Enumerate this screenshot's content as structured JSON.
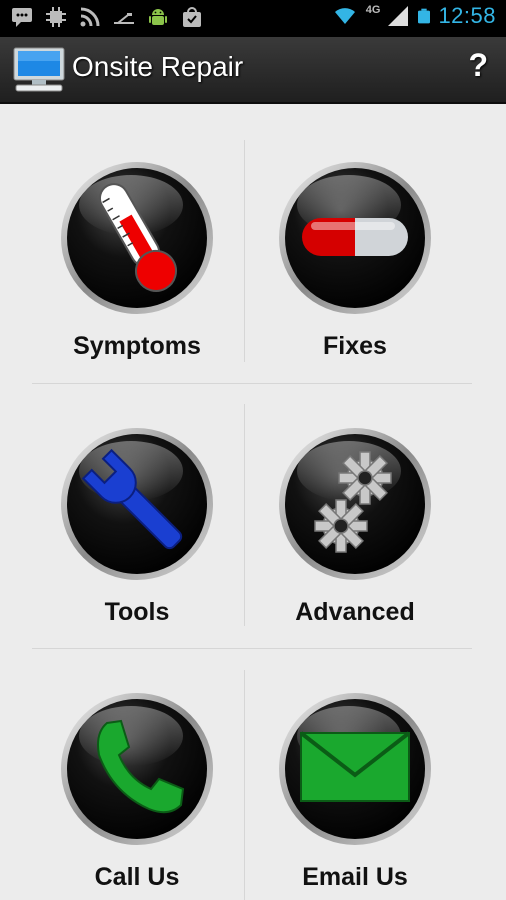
{
  "status_bar": {
    "time": "12:58",
    "network": "4G",
    "left_icons": [
      "talk-icon",
      "chip-icon",
      "rss-icon",
      "usb-icon",
      "android-icon",
      "shopping-bag-icon"
    ],
    "right_icons": [
      "wifi-icon",
      "signal-icon",
      "battery-icon"
    ],
    "accent_color": "#33b5e5"
  },
  "action_bar": {
    "title": "Onsite Repair",
    "help_label": "?"
  },
  "menu": {
    "items": [
      {
        "label": "Symptoms",
        "icon": "thermometer-icon"
      },
      {
        "label": "Fixes",
        "icon": "pill-icon"
      },
      {
        "label": "Tools",
        "icon": "wrench-icon"
      },
      {
        "label": "Advanced",
        "icon": "gears-icon"
      },
      {
        "label": "Call Us",
        "icon": "phone-icon"
      },
      {
        "label": "Email Us",
        "icon": "envelope-icon"
      }
    ]
  }
}
